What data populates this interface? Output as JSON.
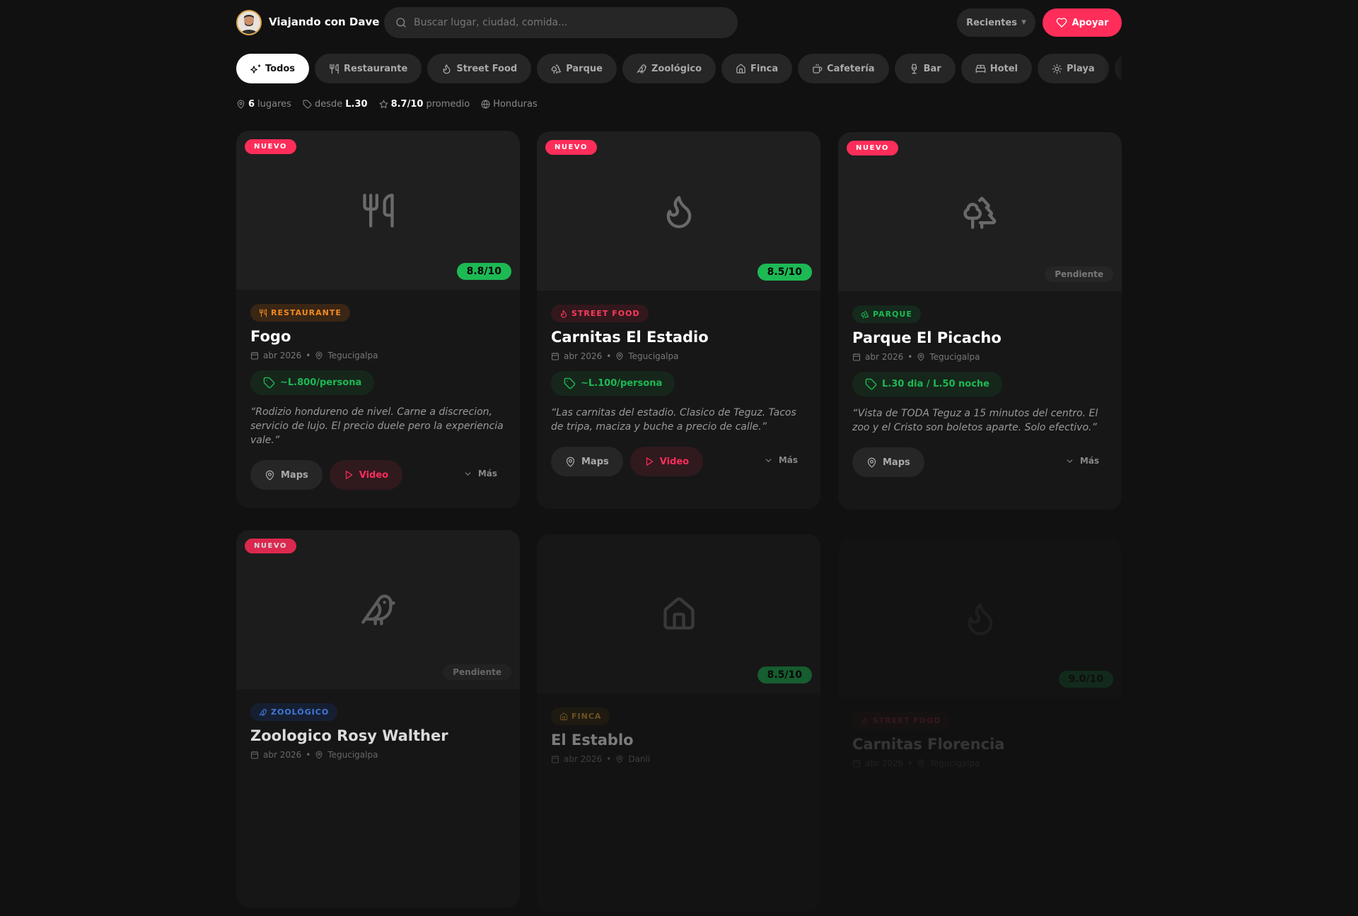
{
  "header": {
    "brand": "Viajando con Dave",
    "search_placeholder": "Buscar lugar, ciudad, comida...",
    "sort_label": "Recientes",
    "support_label": "Apoyar"
  },
  "chips": [
    {
      "label": "Todos",
      "icon": "sparkles-icon"
    },
    {
      "label": "Restaurante",
      "icon": "utensils-icon"
    },
    {
      "label": "Street Food",
      "icon": "flame-icon"
    },
    {
      "label": "Parque",
      "icon": "trees-icon"
    },
    {
      "label": "Zoológico",
      "icon": "bird-icon"
    },
    {
      "label": "Finca",
      "icon": "house-icon"
    },
    {
      "label": "Cafetería",
      "icon": "coffee-icon"
    },
    {
      "label": "Bar",
      "icon": "wine-icon"
    },
    {
      "label": "Hotel",
      "icon": "bed-icon"
    },
    {
      "label": "Playa",
      "icon": "sun-icon"
    }
  ],
  "stats": {
    "count": "6",
    "count_label": "lugares",
    "from_label": "desde",
    "from_value": "L.30",
    "avg_value": "8.7/10",
    "avg_label": "promedio",
    "country": "Honduras"
  },
  "labels": {
    "nuevo": "NUEVO",
    "pendiente": "Pendiente",
    "maps": "Maps",
    "video": "Video",
    "mas": "Más"
  },
  "cards": [
    {
      "category": "RESTAURANTE",
      "cat_color": "#f08a24",
      "cat_bg": "#3a2614",
      "title": "Fogo",
      "date": "abr 2026",
      "city": "Tegucigalpa",
      "price": "~L.800/persona",
      "quote": "“Rodizio hondureno de nivel. Carne a discrecion, servicio de lujo. El precio duele pero la experiencia vale.”",
      "score": "8.8/10",
      "nuevo": true,
      "video": true
    },
    {
      "category": "STREET FOOD",
      "cat_color": "#ff3b5c",
      "cat_bg": "#32181d",
      "title": "Carnitas El Estadio",
      "date": "abr 2026",
      "city": "Tegucigalpa",
      "price": "~L.100/persona",
      "quote": "“Las carnitas del estadio. Clasico de Teguz. Tacos de tripa, maciza y buche a precio de calle.”",
      "score": "8.5/10",
      "nuevo": true,
      "video": true
    },
    {
      "category": "PARQUE",
      "cat_color": "#1db954",
      "cat_bg": "#15291c",
      "title": "Parque El Picacho",
      "date": "abr 2026",
      "city": "Tegucigalpa",
      "price": "L.30 dia / L.50 noche",
      "quote": "“Vista de TODA Teguz a 15 minutos del centro. El zoo y el Cristo son boletos aparte. Solo efectivo.”",
      "score": "Pendiente",
      "nuevo": true,
      "video": false
    },
    {
      "category": "ZOOLÓGICO",
      "cat_color": "#4a8cff",
      "cat_bg": "#182238",
      "title": "Zoologico Rosy Walther",
      "date": "abr 2026",
      "city": "Tegucigalpa",
      "score": "Pendiente",
      "nuevo": true
    },
    {
      "category": "FINCA",
      "cat_color": "#d9a030",
      "cat_bg": "#2e2615",
      "title": "El Establo",
      "date": "abr 2026",
      "city": "Danli",
      "score": "8.5/10",
      "nuevo": false
    },
    {
      "category": "STREET FOOD",
      "cat_color": "#ff3b5c",
      "cat_bg": "#32181d",
      "title": "Carnitas Florencia",
      "date": "abr 2026",
      "city": "Tegucigalpa",
      "score": "9.0/10",
      "nuevo": false
    }
  ]
}
